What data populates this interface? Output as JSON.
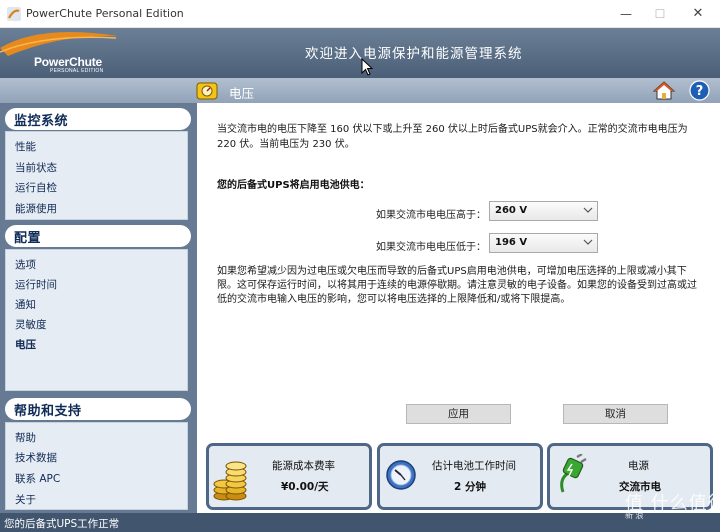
{
  "window": {
    "title": "PowerChute Personal Edition",
    "minimize_glyph": "—",
    "maximize_glyph": "☐",
    "close_glyph": "✕"
  },
  "header": {
    "logo_text": "PowerChute",
    "logo_subtext": "PERSONAL EDITION",
    "title": "欢迎进入电源保护和能源管理系统"
  },
  "subheader": {
    "page_title": "电压",
    "icons": [
      "voltage-icon",
      "home-icon",
      "help-icon"
    ]
  },
  "sidebar": {
    "sections": [
      {
        "title": "监控系统",
        "items": [
          {
            "label": "性能",
            "active": false
          },
          {
            "label": "当前状态",
            "active": false
          },
          {
            "label": "运行自检",
            "active": false
          },
          {
            "label": "能源使用",
            "active": false
          }
        ]
      },
      {
        "title": "配置",
        "items": [
          {
            "label": "选项",
            "active": false
          },
          {
            "label": "运行时间",
            "active": false
          },
          {
            "label": "通知",
            "active": false
          },
          {
            "label": "灵敏度",
            "active": false
          },
          {
            "label": "电压",
            "active": true
          }
        ]
      },
      {
        "title": "帮助和支持",
        "items": [
          {
            "label": "帮助",
            "active": false
          },
          {
            "label": "技术数据",
            "active": false
          },
          {
            "label": "联系 APC",
            "active": false
          },
          {
            "label": "关于",
            "active": false
          }
        ]
      }
    ]
  },
  "main": {
    "intro": "当交流市电的电压下降至 160 伏以下或上升至 260 伏以上时后备式UPS就会介入。正常的交流市电电压为 220 伏。当前电压为 230 伏。",
    "section_title": "您的后备式UPS将启用电池供电：",
    "high_label": "如果交流市电电压高于：",
    "high_value": "260 V",
    "low_label": "如果交流市电电压低于：",
    "low_value": "196 V",
    "note": "如果您希望减少因为过电压或欠电压而导致的后备式UPS启用电池供电，可增加电压选择的上限或减小其下限。这可保存运行时间，以将其用于连续的电源停歇期。请注意灵敏的电子设备。如果您的设备受到过高或过低的交流市电输入电压的影响，您可以将电压选择的上限降低和/或将下限提高。",
    "apply_label": "应用",
    "cancel_label": "取消"
  },
  "cards": {
    "cost_title": "能源成本费率",
    "cost_value": "¥0.00/天",
    "runtime_title": "估计电池工作时间",
    "runtime_value": "2 分钟",
    "source_title": "电源",
    "source_value": "交流市电"
  },
  "status": {
    "text": "您的后备式UPS工作正常"
  },
  "watermark": {
    "text": "值 什么值得买",
    "small": "新 浪"
  },
  "colors": {
    "header": "#566b84",
    "sidebar": "#667b93",
    "nav_text": "#112b54",
    "card_border": "#4f6787",
    "status_bar": "#41556f"
  }
}
